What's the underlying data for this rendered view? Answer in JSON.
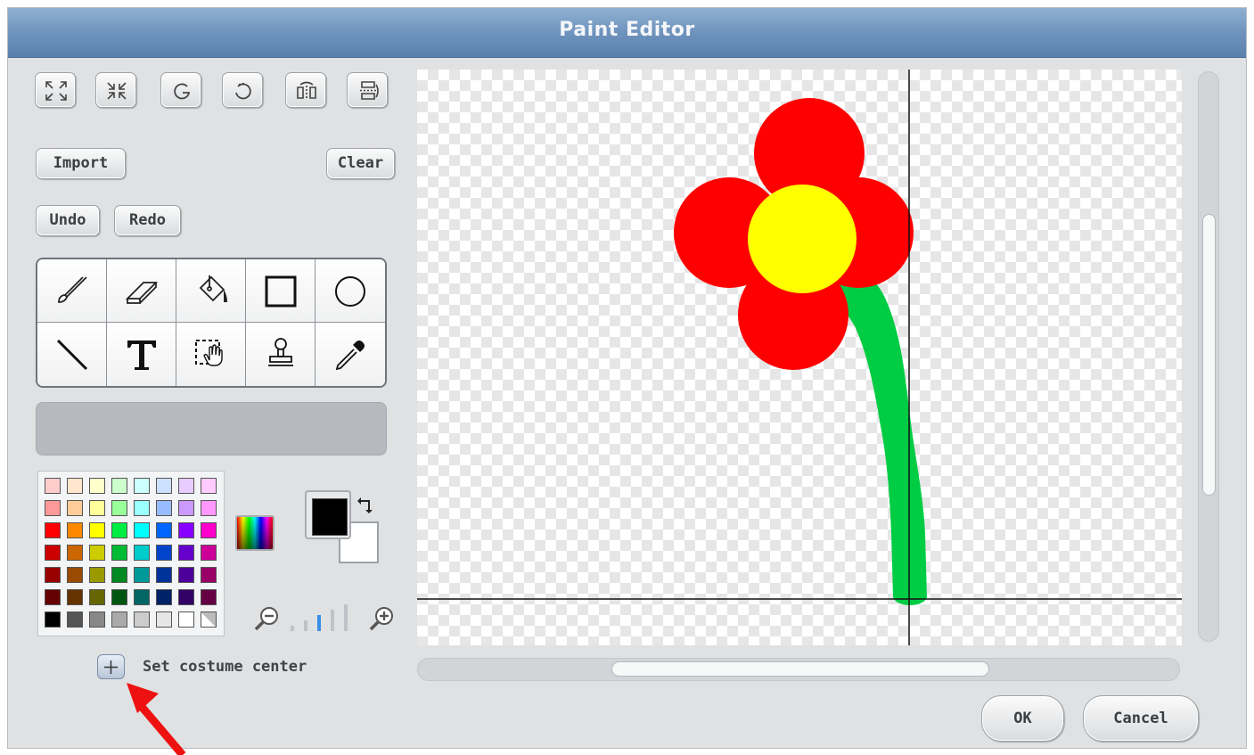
{
  "window": {
    "title": "Paint Editor"
  },
  "transform_tools": [
    {
      "icon": "enlarge-icon"
    },
    {
      "icon": "shrink-icon"
    },
    {
      "icon": "rotate-left-icon"
    },
    {
      "icon": "rotate-right-icon"
    },
    {
      "icon": "flip-horizontal-icon"
    },
    {
      "icon": "flip-vertical-icon"
    }
  ],
  "buttons": {
    "import": "Import",
    "clear": "Clear",
    "undo": "Undo",
    "redo": "Redo",
    "ok": "OK",
    "cancel": "Cancel"
  },
  "tools": [
    {
      "icon": "paintbrush-icon"
    },
    {
      "icon": "eraser-icon"
    },
    {
      "icon": "fill-bucket-icon"
    },
    {
      "icon": "rectangle-icon"
    },
    {
      "icon": "ellipse-icon"
    },
    {
      "icon": "line-icon"
    },
    {
      "icon": "text-tool-icon"
    },
    {
      "icon": "select-icon"
    },
    {
      "icon": "stamp-icon"
    },
    {
      "icon": "eyedropper-icon"
    }
  ],
  "palette": {
    "rows": [
      [
        "#ffcccc",
        "#ffe6cc",
        "#ffffcc",
        "#ccffcc",
        "#ccffff",
        "#cce0ff",
        "#e6ccff",
        "#ffccff"
      ],
      [
        "#ff9999",
        "#ffcc99",
        "#ffff99",
        "#99ff99",
        "#99ffff",
        "#99bbff",
        "#cc99ff",
        "#ff99ff"
      ],
      [
        "#ff0000",
        "#ff8800",
        "#ffff00",
        "#00ee44",
        "#00ffff",
        "#0066ff",
        "#8800ff",
        "#ff00cc"
      ],
      [
        "#cc0000",
        "#cc6600",
        "#cccc00",
        "#00bb33",
        "#00cccc",
        "#0044cc",
        "#6600cc",
        "#cc0099"
      ],
      [
        "#990000",
        "#994c00",
        "#999900",
        "#008822",
        "#009999",
        "#003399",
        "#4c0099",
        "#990066"
      ],
      [
        "#660000",
        "#663300",
        "#666600",
        "#005511",
        "#006666",
        "#002266",
        "#330066",
        "#660044"
      ],
      [
        "#000000",
        "#555555",
        "#888888",
        "#aaaaaa",
        "#cccccc",
        "#e6e6e6",
        "#ffffff",
        "transparent"
      ]
    ],
    "foreground": "#000000",
    "background": "#ffffff"
  },
  "set_costume_center": {
    "label": "Set costume center"
  },
  "zoom": {
    "levels": 5,
    "current": 2
  },
  "annotation": {
    "arrow_color": "#ee1111"
  }
}
